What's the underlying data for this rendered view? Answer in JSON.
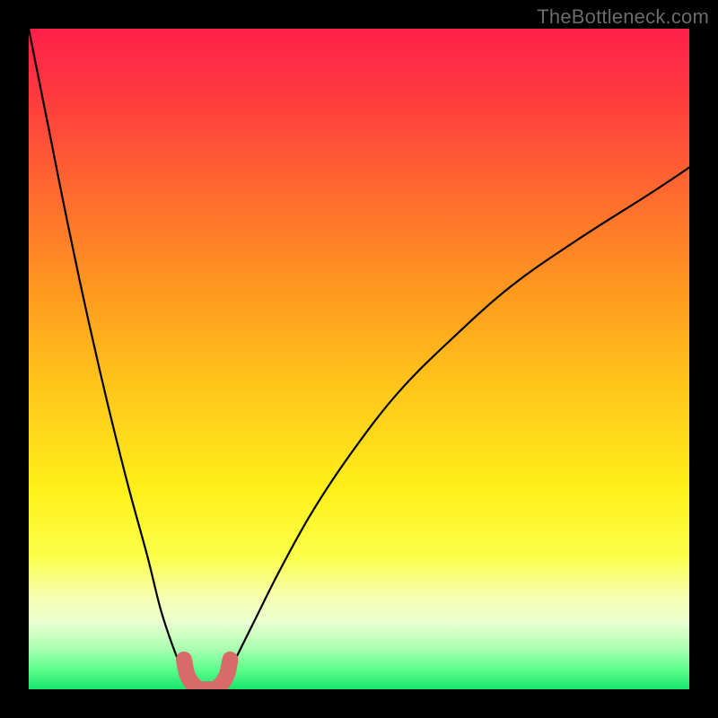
{
  "watermark": "TheBottleneck.com",
  "chart_data": {
    "type": "line",
    "title": "",
    "xlabel": "",
    "ylabel": "",
    "xlim": [
      0,
      100
    ],
    "ylim": [
      0,
      100
    ],
    "grid": false,
    "legend": false,
    "series": [
      {
        "name": "curve-left",
        "x": [
          0,
          3,
          6,
          9,
          12,
          15,
          18,
          20,
          22,
          23.5,
          25
        ],
        "y": [
          100,
          85,
          70,
          56,
          43,
          31,
          20,
          12,
          6,
          2.5,
          0
        ]
      },
      {
        "name": "curve-right",
        "x": [
          29,
          31,
          34,
          38,
          43,
          49,
          56,
          64,
          73,
          83,
          94,
          100
        ],
        "y": [
          0,
          4,
          10,
          18,
          27,
          36,
          45,
          53,
          61,
          68,
          75,
          79
        ]
      },
      {
        "name": "highlight-U",
        "x": [
          23.5,
          24,
          25,
          26,
          27,
          28,
          29,
          30,
          30.5
        ],
        "y": [
          4.5,
          2.2,
          0.6,
          0,
          0,
          0,
          0.6,
          2.2,
          4.5
        ]
      }
    ],
    "gradient_stops": [
      {
        "offset": 0.0,
        "color": "#ff1f4b"
      },
      {
        "offset": 0.1,
        "color": "#ff3a3f"
      },
      {
        "offset": 0.25,
        "color": "#ff6a2f"
      },
      {
        "offset": 0.4,
        "color": "#ff9a1f"
      },
      {
        "offset": 0.55,
        "color": "#ffc81a"
      },
      {
        "offset": 0.7,
        "color": "#fff01a"
      },
      {
        "offset": 0.8,
        "color": "#fbff4a"
      },
      {
        "offset": 0.86,
        "color": "#f6ffb0"
      },
      {
        "offset": 0.9,
        "color": "#e8ffd0"
      },
      {
        "offset": 0.94,
        "color": "#a8ffb0"
      },
      {
        "offset": 0.97,
        "color": "#5cff8c"
      },
      {
        "offset": 1.0,
        "color": "#16e56b"
      }
    ],
    "colors": {
      "curve": "#000000",
      "highlight": "#d96a6a"
    }
  }
}
